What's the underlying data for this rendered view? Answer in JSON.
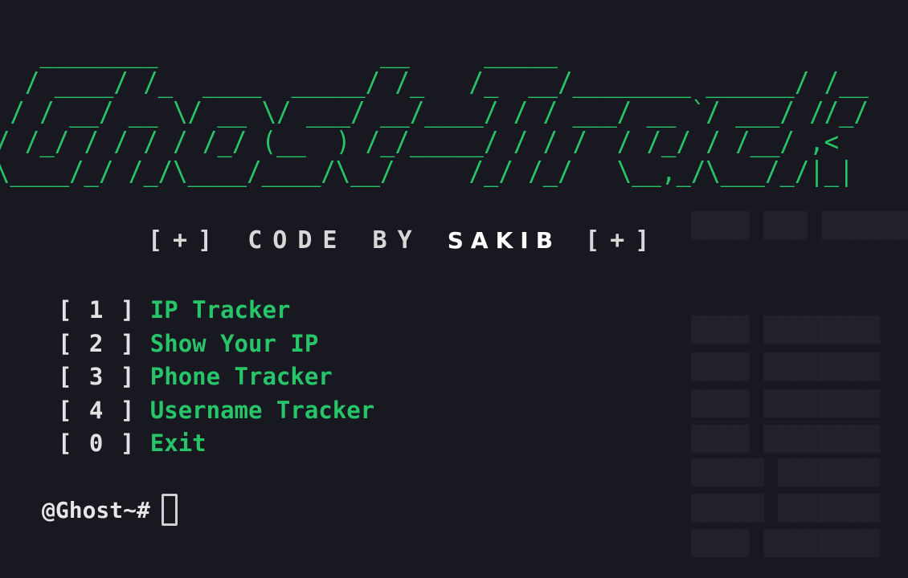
{
  "banner": {
    "ascii_art": "   ________               __     _____\n  / ____/ /_  ____  _____/ /_   /_  __/________ ______/ /__\n / / __/ __ \\/ __ \\/ ___/ __/____/ / / ___/ __ `/ ___/ //_/\n/ /_/ / / / / /_/ (__  ) /_/_____/ / / /  / /_/ / /__/ ,<\n\\____/_/ /_/\\____/____/\\__/     /_/ /_/   \\__,_/\\___/_/|_|",
    "color": "#27c46a"
  },
  "credit": {
    "prefix": "[+] CODE BY ",
    "name": "SAKIB",
    "suffix": " [+]"
  },
  "menu": {
    "items": [
      {
        "number": "[ 1 ]",
        "label": "IP Tracker"
      },
      {
        "number": "[ 2 ]",
        "label": "Show Your IP"
      },
      {
        "number": "[ 3 ]",
        "label": "Phone Tracker"
      },
      {
        "number": "[ 4 ]",
        "label": "Username Tracker"
      },
      {
        "number": "[ 0 ]",
        "label": "Exit"
      }
    ]
  },
  "prompt": {
    "text": "@Ghost~#"
  },
  "colors": {
    "background": "#181820",
    "accent_green": "#27c46a",
    "text_white": "#e6e6e6"
  }
}
